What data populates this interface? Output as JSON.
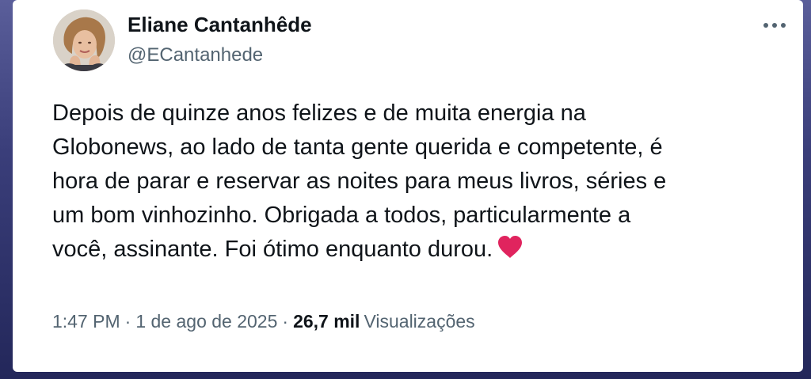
{
  "author": {
    "display_name": "Eliane Cantanhêde",
    "handle": "@ECantanhede"
  },
  "tweet": {
    "lines": [
      "Depois de quinze anos felizes e de muita energia na",
      "Globonews, ao lado de tanta gente querida e competente, é",
      "hora de parar e reservar as noites para meus livros, séries e",
      "um bom vinhozinho. Obrigada a todos, particularmente a",
      "você, assinante. Foi ótimo enquanto durou."
    ],
    "emoji": "heart-icon"
  },
  "meta": {
    "time": "1:47 PM",
    "separator": "·",
    "date": "1 de ago de 2025",
    "views_count": "26,7 mil",
    "views_label": "Visualizações"
  },
  "icons": {
    "more": "more-horizontal-icon",
    "heart": "heart-icon"
  },
  "colors": {
    "heart": "#e0245e",
    "secondary_text": "#536471",
    "primary_text": "#0f1419"
  }
}
